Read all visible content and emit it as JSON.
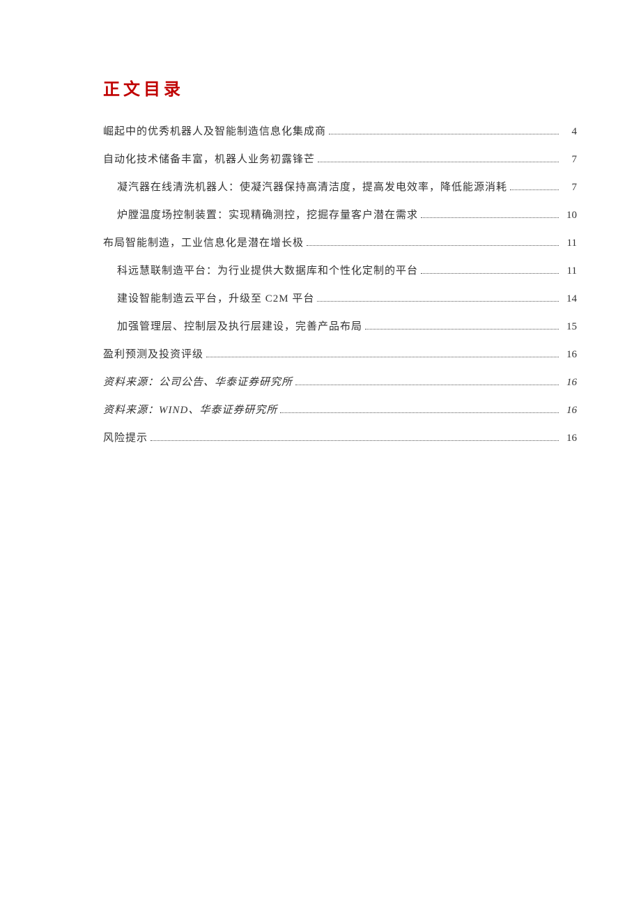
{
  "title": "正文目录",
  "entries": [
    {
      "text": "崛起中的优秀机器人及智能制造信息化集成商",
      "page": "4",
      "level": 1,
      "italic": false
    },
    {
      "text": "自动化技术储备丰富，机器人业务初露锋芒",
      "page": "7",
      "level": 1,
      "italic": false
    },
    {
      "text": "凝汽器在线清洗机器人：使凝汽器保持高清洁度，提高发电效率，降低能源消耗",
      "page": "7",
      "level": 2,
      "italic": false
    },
    {
      "text": "炉膛温度场控制装置：实现精确测控，挖掘存量客户潜在需求",
      "page": "10",
      "level": 2,
      "italic": false
    },
    {
      "text": "布局智能制造，工业信息化是潜在增长极",
      "page": "11",
      "level": 1,
      "italic": false
    },
    {
      "text": "科远慧联制造平台：为行业提供大数据库和个性化定制的平台",
      "page": "11",
      "level": 2,
      "italic": false
    },
    {
      "text": "建设智能制造云平台，升级至 C2M 平台",
      "page": "14",
      "level": 2,
      "italic": false
    },
    {
      "text": "加强管理层、控制层及执行层建设，完善产品布局",
      "page": "15",
      "level": 2,
      "italic": false
    },
    {
      "text": "盈利预测及投资评级",
      "page": "16",
      "level": 1,
      "italic": false
    },
    {
      "text": "资料来源：公司公告、华泰证券研究所",
      "page": "16",
      "level": 1,
      "italic": true
    },
    {
      "text": "资料来源：WIND、华泰证券研究所",
      "page": "16",
      "level": 1,
      "italic": true
    },
    {
      "text": "风险提示",
      "page": "16",
      "level": 1,
      "italic": false
    }
  ]
}
